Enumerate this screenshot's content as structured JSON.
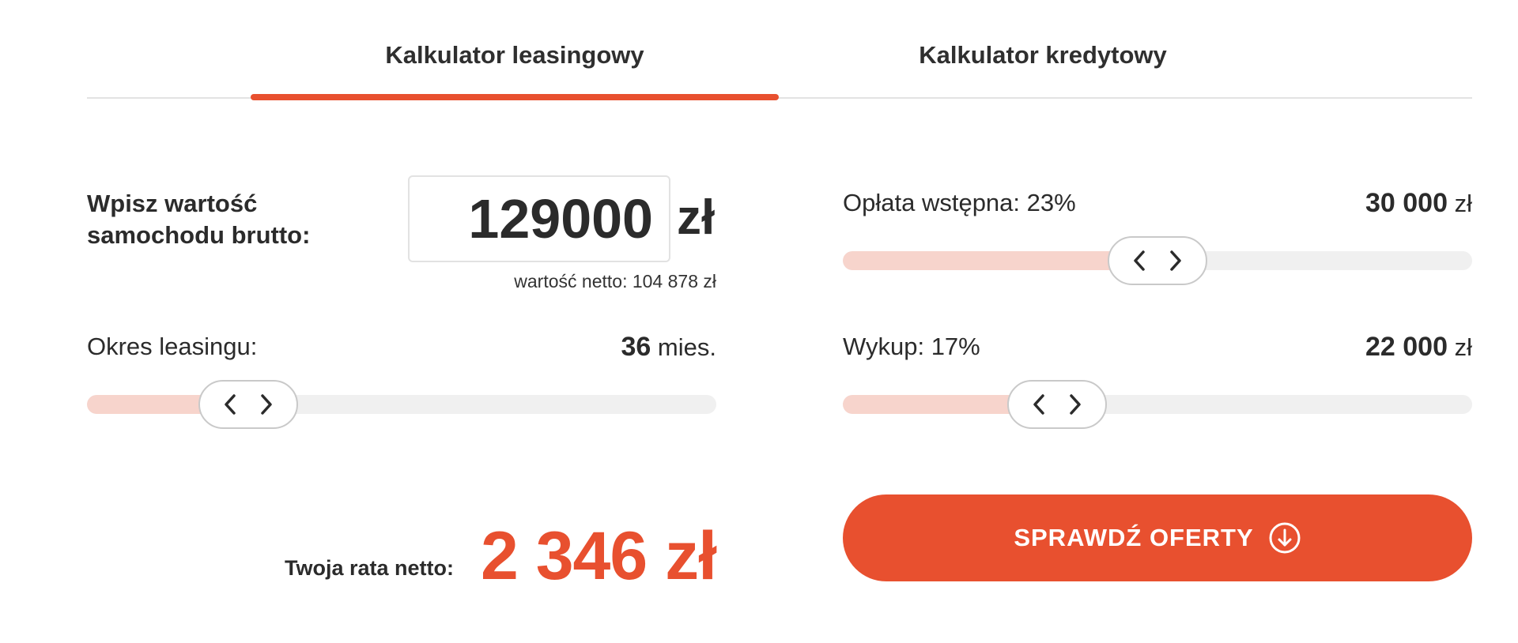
{
  "tabs": [
    {
      "label": "Kalkulator leasingowy",
      "active": true
    },
    {
      "label": "Kalkulator kredytowy",
      "active": false
    }
  ],
  "car_value": {
    "label_line1": "Wpisz wartość",
    "label_line2": "samochodu brutto:",
    "value": "129000",
    "unit": "zł",
    "netto_text": "wartość netto: 104 878 zł"
  },
  "leasing_period": {
    "label": "Okres leasingu:",
    "value": "36",
    "unit": "mies.",
    "level": 0.21
  },
  "down_payment": {
    "label": "Opłata wstępna: 23%",
    "value": "30 000",
    "unit": "zł",
    "level": 0.5
  },
  "buyout": {
    "label": "Wykup: 17%",
    "value": "22 000",
    "unit": "zł",
    "level": 0.31
  },
  "result": {
    "label": "Twoja rata netto:",
    "value": "2 346 zł"
  },
  "cta": {
    "label": "SPRAWDŹ OFERTY",
    "icon": "arrow-down-circle-icon"
  },
  "colors": {
    "accent": "#e8502f",
    "slider_fill": "#f7d4cc",
    "slider_track": "#f0f0f0"
  }
}
